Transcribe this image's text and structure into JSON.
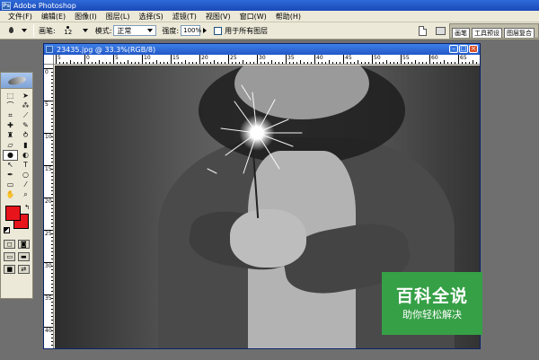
{
  "app": {
    "title": "Adobe Photoshop"
  },
  "menu": [
    "文件(F)",
    "编辑(E)",
    "图像(I)",
    "图层(L)",
    "选择(S)",
    "滤镜(T)",
    "视图(V)",
    "窗口(W)",
    "帮助(H)"
  ],
  "options": {
    "brush_label": "画笔:",
    "brush_size": "12",
    "mode_label": "模式:",
    "mode_value": "正常",
    "strength_label": "强度:",
    "strength_value": "100%",
    "all_layers_label": "用于所有图层",
    "palette_tabs": [
      "画笔",
      "工具预设",
      "图层复合"
    ]
  },
  "document": {
    "title": "23435.jpg @ 33.3%(RGB/8)",
    "ruler_h_labels": [
      "5",
      "0",
      "5",
      "10",
      "15",
      "20",
      "25",
      "30",
      "35",
      "40",
      "45",
      "50",
      "55",
      "60",
      "65"
    ],
    "ruler_v_labels": [
      "0",
      "5",
      "10",
      "15",
      "20",
      "25",
      "30",
      "35",
      "40"
    ]
  },
  "colors": {
    "foreground": "#e8141c",
    "background": "#e8141c",
    "watermark": "#36a046"
  },
  "watermark": {
    "title": "百科全说",
    "subtitle": "助你轻松解决"
  }
}
